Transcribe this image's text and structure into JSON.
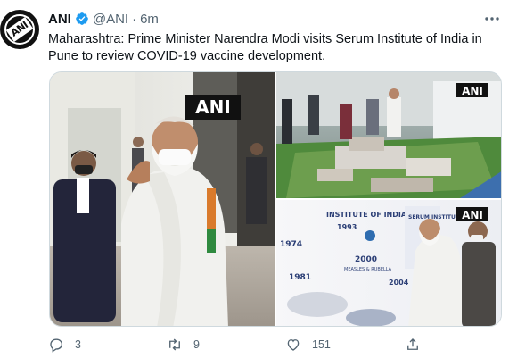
{
  "tweet": {
    "author_name": "ANI",
    "author_handle": "@ANI",
    "separator": "·",
    "time": "6m",
    "avatar_text": "ANI",
    "text": "Maharashtra: Prime Minister Narendra Modi visits Serum Institute of India in Pune to review COVID-19 vaccine development."
  },
  "media": {
    "watermark_1": "ANI",
    "watermark_2": "ANI",
    "watermark_3": "ANI",
    "board_title": "INSTITUTE OF INDIA",
    "board_brand": "SERUM INSTITUTE",
    "board_years": [
      "1974",
      "1981",
      "1993",
      "2000",
      "2004"
    ],
    "board_caption": "MEASLES & RUBELLA"
  },
  "actions": {
    "reply_count": "3",
    "retweet_count": "9",
    "like_count": "151"
  },
  "icons": {
    "verified": "verified-badge-icon",
    "more": "more-icon",
    "reply": "reply-icon",
    "retweet": "retweet-icon",
    "like": "like-icon",
    "share": "share-icon"
  },
  "colors": {
    "verified": "#1d9bf0",
    "secondary_text": "#536471"
  }
}
